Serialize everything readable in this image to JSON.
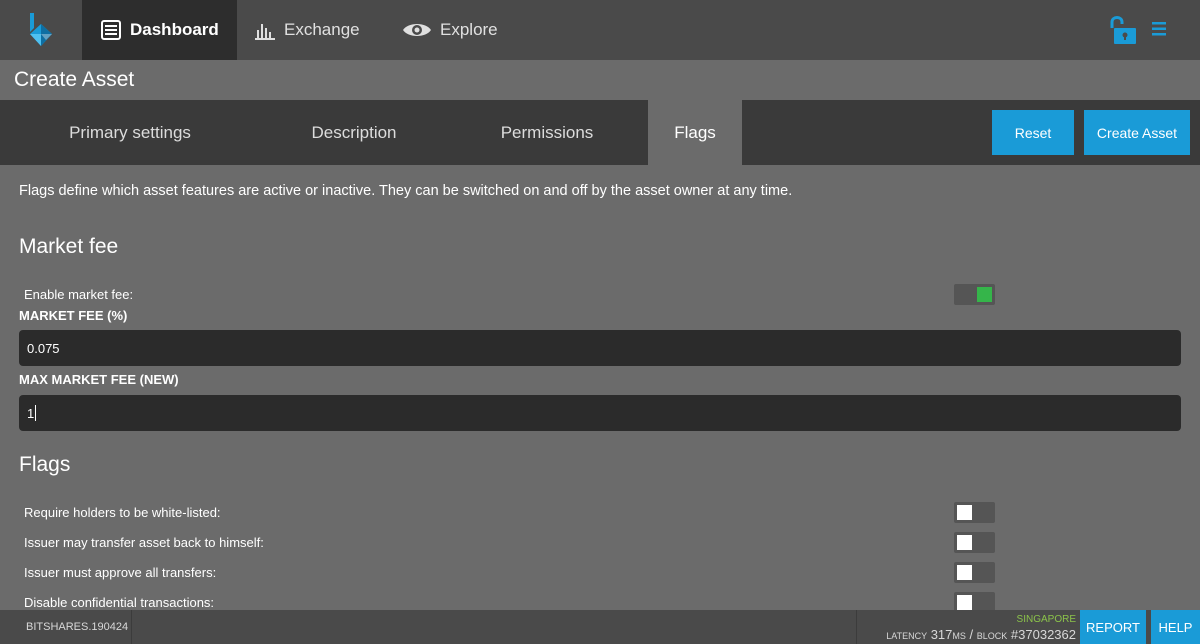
{
  "colors": {
    "accent": "#1a9bd7",
    "toggle_on": "#35b54a",
    "topbar_bg": "#4a4a4a",
    "content_bg": "#6b6b6b",
    "input_bg": "#2b2b2b",
    "location_text": "#8bc34a"
  },
  "nav": {
    "logo_icon": "bitshares-logo",
    "items": [
      {
        "label": "Dashboard",
        "icon": "dashboard-icon",
        "active": true
      },
      {
        "label": "Exchange",
        "icon": "bar-chart-icon",
        "active": false
      },
      {
        "label": "Explore",
        "icon": "eye-icon",
        "active": false
      }
    ],
    "lock_icon": "unlocked-padlock-icon",
    "menu_icon": "hamburger-menu-icon"
  },
  "page": {
    "title": "Create Asset"
  },
  "tabs": [
    {
      "label": "Primary settings",
      "active": false
    },
    {
      "label": "Description",
      "active": false
    },
    {
      "label": "Permissions",
      "active": false
    },
    {
      "label": "Flags",
      "active": true
    }
  ],
  "actions": {
    "reset_label": "Reset",
    "create_label": "Create Asset"
  },
  "content": {
    "intro": "Flags define which asset features are active or inactive. They can be switched on and off by the asset owner at any time.",
    "market_fee": {
      "heading": "Market fee",
      "enable_label": "Enable market fee:",
      "enabled": true,
      "fee_label": "MARKET FEE (%)",
      "fee_value": "0.075",
      "max_label": "MAX MARKET FEE (NEW)",
      "max_value": "1"
    },
    "flags": {
      "heading": "Flags",
      "items": [
        {
          "label": "Require holders to be white-listed:",
          "enabled": false
        },
        {
          "label": "Issuer may transfer asset back to himself:",
          "enabled": false
        },
        {
          "label": "Issuer must approve all transfers:",
          "enabled": false
        },
        {
          "label": "Disable confidential transactions:",
          "enabled": false
        }
      ]
    }
  },
  "footer": {
    "version": "BITSHARES.190424",
    "location": "SINGAPORE",
    "latency_label": "LATENCY",
    "latency_value": "317",
    "latency_unit": "MS",
    "separator": "/",
    "block_label": "BLOCK",
    "block_value": "#37032362",
    "report_label": "REPORT",
    "help_label": "HELP"
  }
}
